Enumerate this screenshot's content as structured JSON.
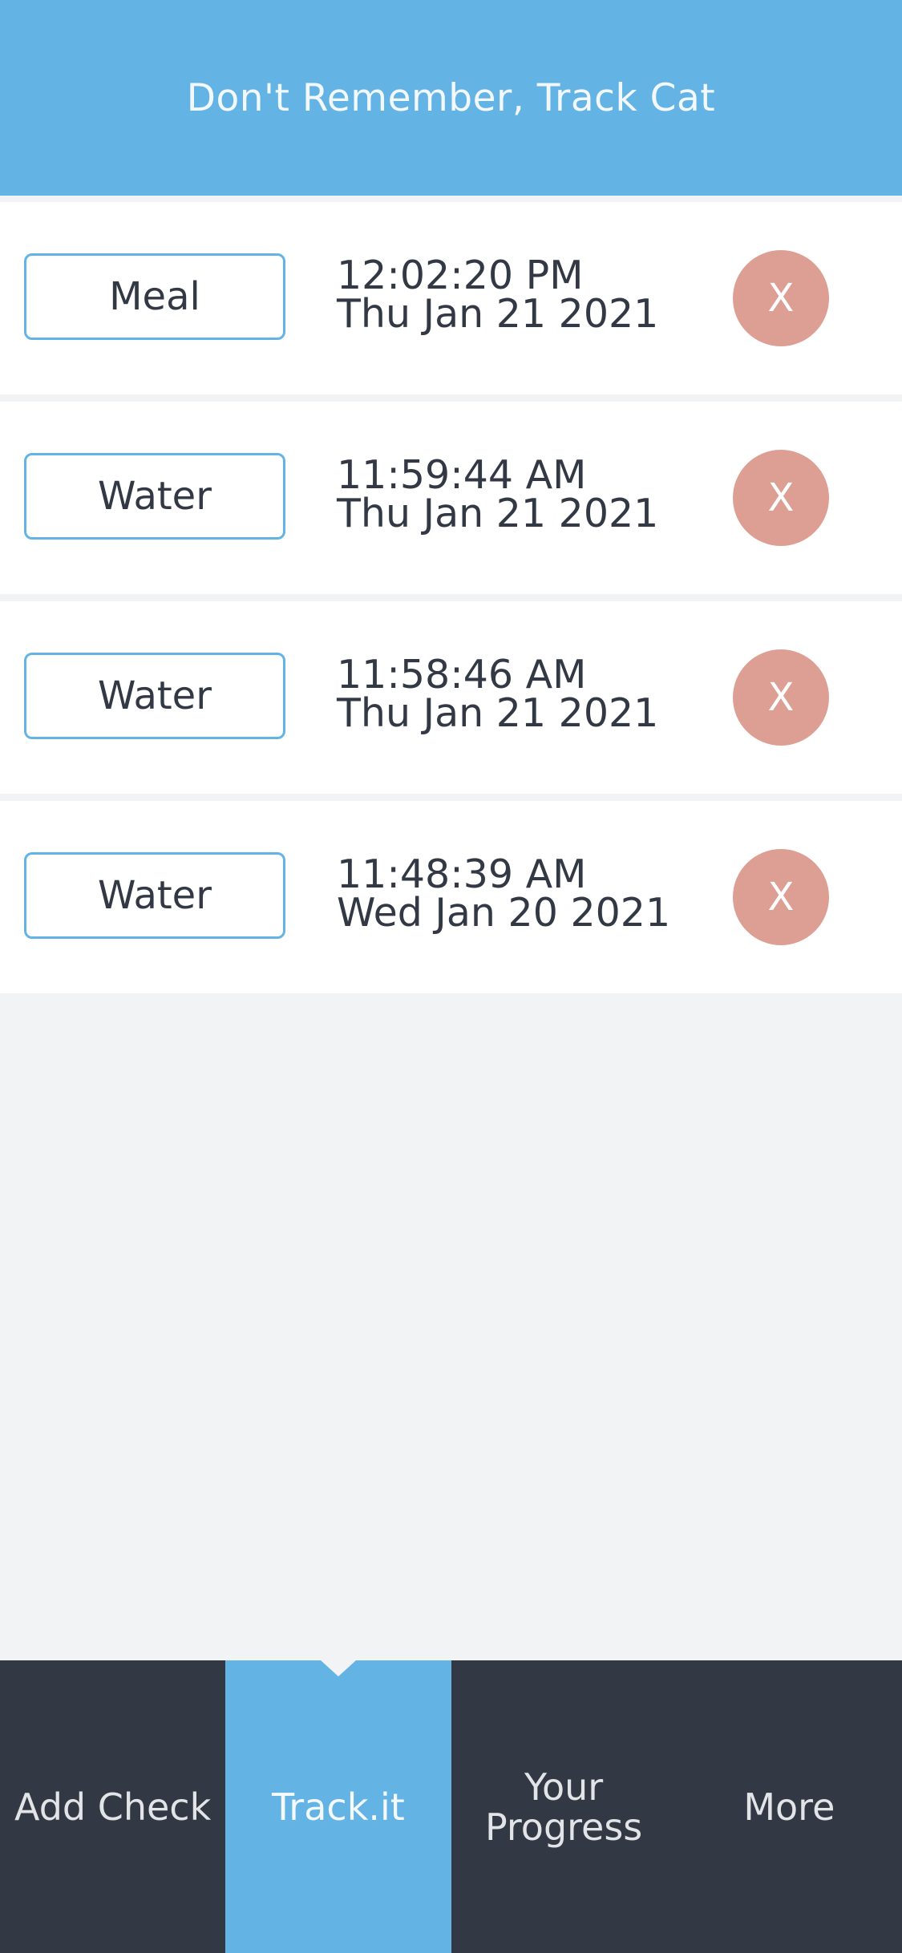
{
  "header": {
    "title": "Don't Remember, Track Cat"
  },
  "entries": [
    {
      "type": "Meal",
      "time": "12:02:20 PM",
      "date": "Thu Jan 21 2021",
      "delete_label": "X"
    },
    {
      "type": "Water",
      "time": "11:59:44 AM",
      "date": "Thu Jan 21 2021",
      "delete_label": "X"
    },
    {
      "type": "Water",
      "time": "11:58:46 AM",
      "date": "Thu Jan 21 2021",
      "delete_label": "X"
    },
    {
      "type": "Water",
      "time": "11:48:39 AM",
      "date": "Wed Jan 20 2021",
      "delete_label": "X"
    }
  ],
  "tabs": [
    {
      "label": "Add Check",
      "active": false
    },
    {
      "label": "Track.it",
      "active": true
    },
    {
      "label": "Your Progress",
      "active": false
    },
    {
      "label": "More",
      "active": false
    }
  ],
  "colors": {
    "header": "#63b4e4",
    "delete": "#dd9e93",
    "tabbar": "#323844",
    "background": "#f2f3f5"
  }
}
